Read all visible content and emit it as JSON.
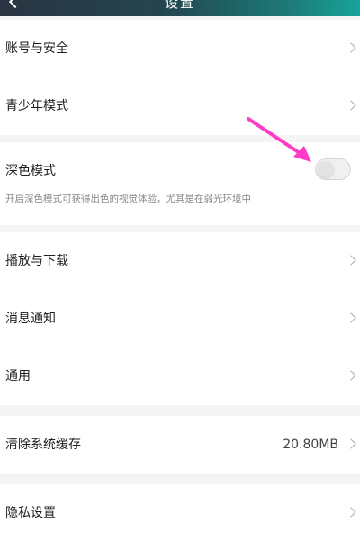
{
  "header": {
    "title": "设置"
  },
  "groups": {
    "account": [
      {
        "label": "账号与安全"
      },
      {
        "label": "青少年模式"
      }
    ],
    "dark_mode": {
      "label": "深色模式",
      "description": "开启深色模式可获得出色的视觉体验，尤其是在弱光环境中",
      "enabled": false
    },
    "general": [
      {
        "label": "播放与下载"
      },
      {
        "label": "消息通知"
      },
      {
        "label": "通用"
      }
    ],
    "cache": {
      "label": "清除系统缓存",
      "value": "20.80MB"
    },
    "privacy": {
      "label": "隐私设置"
    }
  },
  "colors": {
    "header_start": "#2a3442",
    "header_end": "#17a49a",
    "annotation_arrow": "#ff3cc8",
    "background": "#f4f4f4"
  },
  "icons": [
    "back-icon",
    "chevron-right-icon",
    "annotation-arrow-icon"
  ]
}
